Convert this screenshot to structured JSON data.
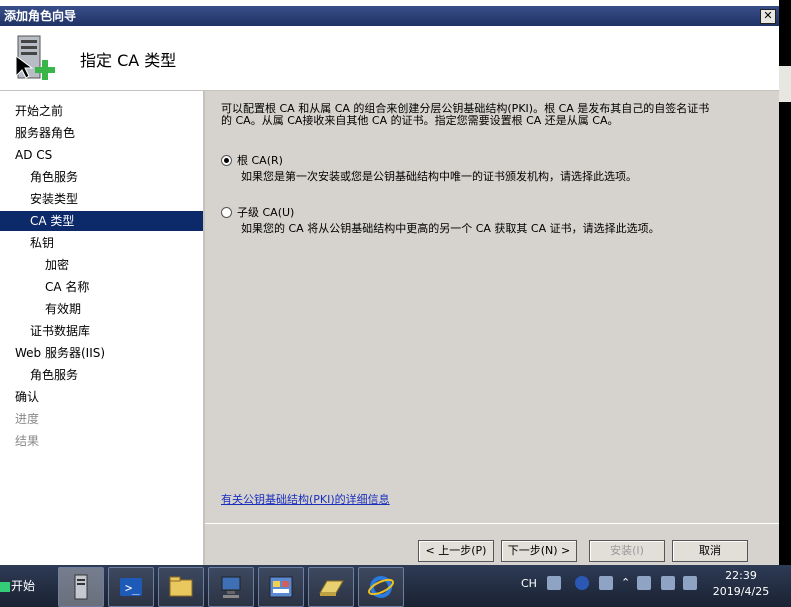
{
  "window": {
    "title": "添加角色向导",
    "close_label": "✕"
  },
  "header": {
    "title": "指定 CA 类型",
    "icon": "server-add-icon"
  },
  "nav": {
    "items": [
      {
        "label": "开始之前",
        "level": 0,
        "state": "normal"
      },
      {
        "label": "服务器角色",
        "level": 0,
        "state": "normal"
      },
      {
        "label": "AD CS",
        "level": 0,
        "state": "normal"
      },
      {
        "label": "角色服务",
        "level": 1,
        "state": "normal"
      },
      {
        "label": "安装类型",
        "level": 1,
        "state": "normal"
      },
      {
        "label": "CA 类型",
        "level": 1,
        "state": "active"
      },
      {
        "label": "私钥",
        "level": 1,
        "state": "normal"
      },
      {
        "label": "加密",
        "level": 2,
        "state": "normal"
      },
      {
        "label": "CA 名称",
        "level": 2,
        "state": "normal"
      },
      {
        "label": "有效期",
        "level": 2,
        "state": "normal"
      },
      {
        "label": "证书数据库",
        "level": 1,
        "state": "normal"
      },
      {
        "label": "Web 服务器(IIS)",
        "level": 0,
        "state": "normal"
      },
      {
        "label": "角色服务",
        "level": 1,
        "state": "normal"
      },
      {
        "label": "确认",
        "level": 0,
        "state": "normal"
      },
      {
        "label": "进度",
        "level": 0,
        "state": "disabled"
      },
      {
        "label": "结果",
        "level": 0,
        "state": "disabled"
      }
    ]
  },
  "main": {
    "intro_line1": "可以配置根 CA 和从属 CA 的组合来创建分层公钥基础结构(PKI)。根 CA 是发布其自己的自签名证书",
    "intro_line2": "的 CA。从属 CA接收来自其他 CA 的证书。指定您需要设置根 CA 还是从属 CA。",
    "options": [
      {
        "label": "根 CA(R)",
        "description": "如果您是第一次安装或您是公钥基础结构中唯一的证书颁发机构，请选择此选项。",
        "checked": true
      },
      {
        "label": "子级 CA(U)",
        "description": "如果您的 CA 将从公钥基础结构中更高的另一个 CA 获取其 CA 证书，请选择此选项。",
        "checked": false
      }
    ],
    "more_info_link": "有关公钥基础结构(PKI)的详细信息"
  },
  "buttons": {
    "back": "< 上一步(P)",
    "next": "下一步(N) >",
    "install": "安装(I)",
    "cancel": "取消"
  },
  "taskbar": {
    "start_label": "开始",
    "apps": [
      "server-manager-icon",
      "powershell-icon",
      "explorer-icon",
      "network-icon",
      "control-panel-icon",
      "folder-icon",
      "ie-icon"
    ],
    "tray": {
      "language": "CH",
      "time": "22:39",
      "date": "2019/4/25"
    }
  },
  "colors": {
    "nav_active": "#0c2a6a",
    "panel_bg": "#d6d3ce",
    "link": "#1a2fbe"
  }
}
